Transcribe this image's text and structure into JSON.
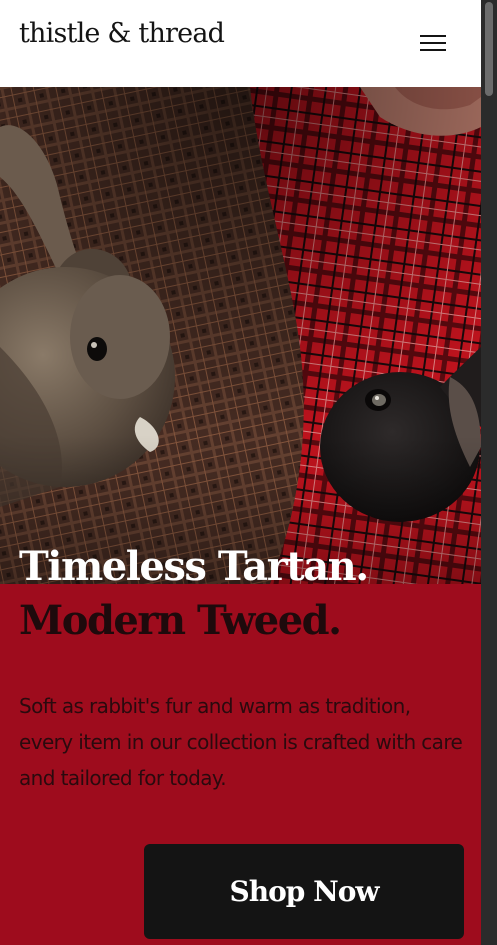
{
  "header": {
    "brand": "thistle & thread",
    "menu_icon": "hamburger-menu-icon"
  },
  "hero": {
    "image_subject": "rabbits on tartan and tweed fabric",
    "headline_line1": "Timeless Tartan.",
    "headline_line2": "Modern Tweed.",
    "body": "Soft as rabbit's fur and warm as tradition, every item in our collection is crafted with care and tailored for today.",
    "cta_label": "Shop Now"
  },
  "colors": {
    "accent": "#9e0c1d",
    "header_bg": "#ffffff",
    "button_bg": "#141414",
    "headline_light": "#ffffff",
    "headline_dark": "#1e0a0c"
  }
}
